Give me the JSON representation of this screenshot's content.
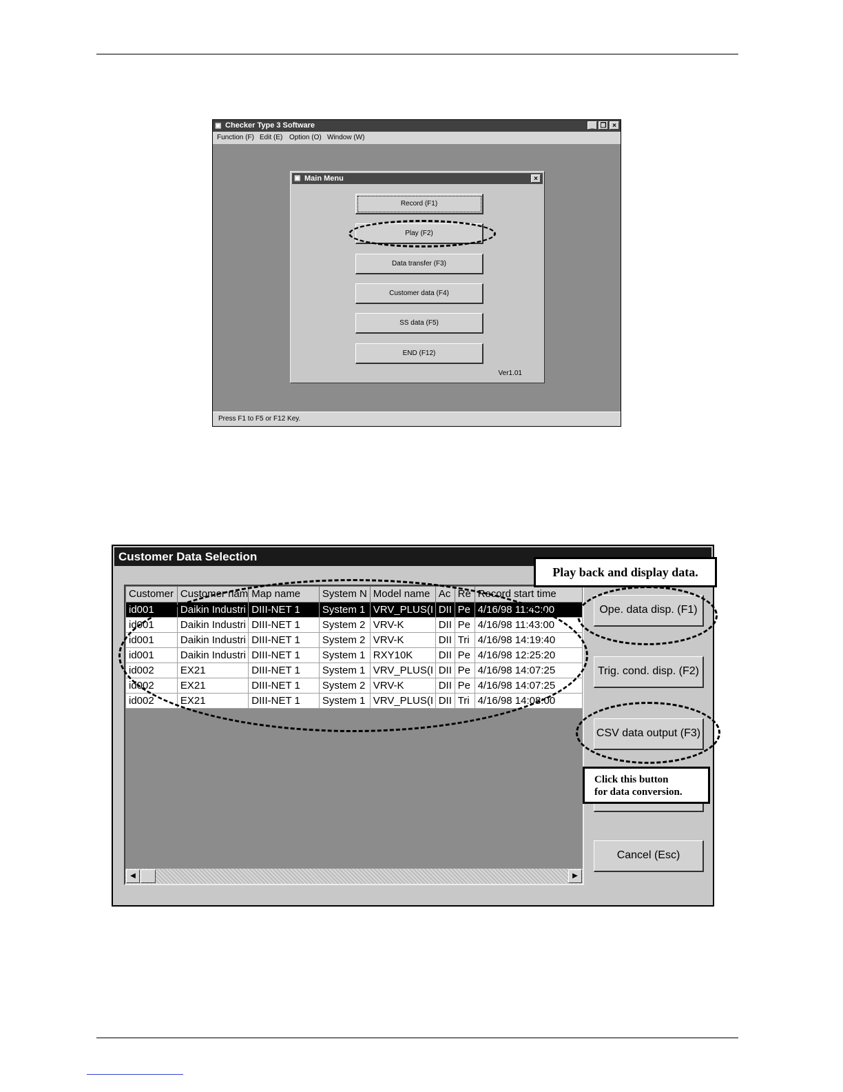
{
  "main_window": {
    "title": "Checker Type 3 Software",
    "caption_buttons": [
      "_",
      "ɐ",
      "×"
    ],
    "menu": [
      "Function (F)",
      "Edit (E)",
      "Option (O)",
      "Window (W)"
    ],
    "status": "Press F1 to F5 or F12 Key."
  },
  "main_menu": {
    "title": "Main Menu",
    "close": "×",
    "buttons": [
      "Record (F1)",
      "Play (F2)",
      "Data transfer (F3)",
      "Customer data (F4)",
      "SS data (F5)",
      "END (F12)"
    ],
    "version": "Ver1.01"
  },
  "selection": {
    "title": "Customer Data Selection",
    "columns": [
      "Customer",
      "Customer nam",
      "Map name",
      "System N",
      "Model name",
      "Ac",
      "Re",
      "Record start time"
    ],
    "rows": [
      [
        "id001",
        "Daikin Industri",
        "DIII-NET 1",
        "System 1",
        "VRV_PLUS(I",
        "DII",
        "Pe",
        "4/16/98 11:43:00"
      ],
      [
        "id001",
        "Daikin Industri",
        "DIII-NET 1",
        "System 2",
        "VRV-K",
        "DII",
        "Pe",
        "4/16/98 11:43:00"
      ],
      [
        "id001",
        "Daikin Industri",
        "DIII-NET 1",
        "System 2",
        "VRV-K",
        "DII",
        "Tri",
        "4/16/98 14:19:40"
      ],
      [
        "id001",
        "Daikin Industri",
        "DIII-NET 1",
        "System 1",
        "RXY10K",
        "DII",
        "Pe",
        "4/16/98 12:25:20"
      ],
      [
        "id002",
        "EX21",
        "DIII-NET 1",
        "System 1",
        "VRV_PLUS(I",
        "DII",
        "Pe",
        "4/16/98 14:07:25"
      ],
      [
        "id002",
        "EX21",
        "DIII-NET 1",
        "System 2",
        "VRV-K",
        "DII",
        "Pe",
        "4/16/98 14:07:25"
      ],
      [
        "id002",
        "EX21",
        "DIII-NET 1",
        "System 1",
        "VRV_PLUS(I",
        "DII",
        "Tri",
        "4/16/98 14:08:00"
      ]
    ],
    "selected_row": 0,
    "buttons": {
      "ope": "Ope. data disp. (F1)",
      "trig": "Trig. cond. disp. (F2)",
      "csv": "CSV data output (F3)",
      "cancel": "Cancel (Esc)"
    },
    "scroll_left": "◀",
    "scroll_right": "▶"
  },
  "callouts": {
    "playback": "Play back and display data.",
    "click_line1": "Click this button",
    "click_line2": "for data conversion."
  }
}
